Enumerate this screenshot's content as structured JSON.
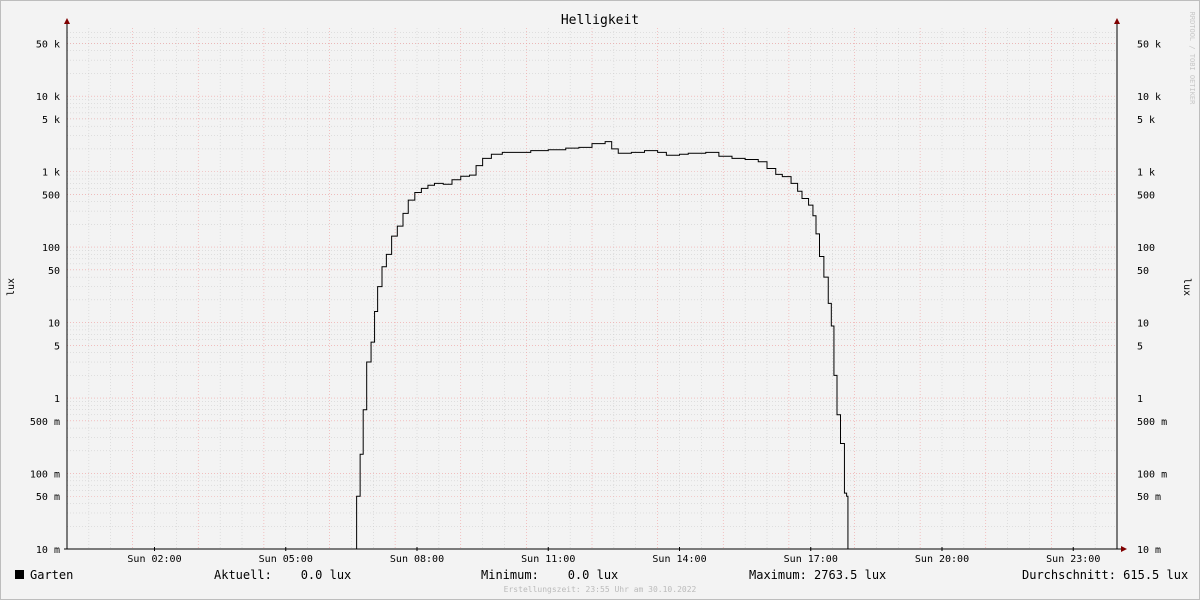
{
  "watermark": "RRDTOOL / TOBI OETIKER",
  "footer": "Erstellungszeit: 23:55 Uhr am 30.10.2022",
  "legend": {
    "series": "Garten",
    "current": "Aktuell:    0.0 lux",
    "minimum": "Minimum:    0.0 lux",
    "maximum": "Maximum: 2763.5 lux",
    "average": "Durchschnitt: 615.5 lux"
  },
  "colors": {
    "line": "#000000",
    "major_grid": "#f0a0a0",
    "minor_grid": "#c8c8c8",
    "axis_arrow": "#800000"
  },
  "chart_data": {
    "type": "line",
    "title": "Helligkeit",
    "ylabel": "lux",
    "yscale": "log",
    "ylim": [
      0.01,
      80000
    ],
    "xlim_hours": [
      0,
      24
    ],
    "grid": true,
    "x_ticks": [
      {
        "hour": 2,
        "label": "Sun 02:00"
      },
      {
        "hour": 5,
        "label": "Sun 05:00"
      },
      {
        "hour": 8,
        "label": "Sun 08:00"
      },
      {
        "hour": 11,
        "label": "Sun 11:00"
      },
      {
        "hour": 14,
        "label": "Sun 14:00"
      },
      {
        "hour": 17,
        "label": "Sun 17:00"
      },
      {
        "hour": 20,
        "label": "Sun 20:00"
      },
      {
        "hour": 23,
        "label": "Sun 23:00"
      }
    ],
    "y_ticks": [
      {
        "value": 0.01,
        "label": "10 m"
      },
      {
        "value": 0.05,
        "label": "50 m"
      },
      {
        "value": 0.1,
        "label": "100 m"
      },
      {
        "value": 0.5,
        "label": "500 m"
      },
      {
        "value": 1,
        "label": "1"
      },
      {
        "value": 5,
        "label": "5"
      },
      {
        "value": 10,
        "label": "10"
      },
      {
        "value": 50,
        "label": "50"
      },
      {
        "value": 100,
        "label": "100"
      },
      {
        "value": 500,
        "label": "500"
      },
      {
        "value": 1000,
        "label": "1 k"
      },
      {
        "value": 5000,
        "label": "5 k"
      },
      {
        "value": 10000,
        "label": "10 k"
      },
      {
        "value": 50000,
        "label": "50 k"
      }
    ],
    "series": [
      {
        "name": "Garten",
        "step": true,
        "points": [
          [
            0,
            0.01
          ],
          [
            6.6,
            0.01
          ],
          [
            6.62,
            0.05
          ],
          [
            6.7,
            0.18
          ],
          [
            6.77,
            0.7
          ],
          [
            6.85,
            3
          ],
          [
            6.95,
            5.5
          ],
          [
            7.03,
            14
          ],
          [
            7.1,
            30
          ],
          [
            7.2,
            55
          ],
          [
            7.3,
            80
          ],
          [
            7.42,
            140
          ],
          [
            7.55,
            190
          ],
          [
            7.68,
            280
          ],
          [
            7.8,
            420
          ],
          [
            7.95,
            530
          ],
          [
            8.1,
            600
          ],
          [
            8.25,
            660
          ],
          [
            8.4,
            700
          ],
          [
            8.6,
            680
          ],
          [
            8.8,
            780
          ],
          [
            9.0,
            870
          ],
          [
            9.2,
            900
          ],
          [
            9.35,
            1200
          ],
          [
            9.5,
            1500
          ],
          [
            9.7,
            1700
          ],
          [
            9.95,
            1800
          ],
          [
            10.3,
            1800
          ],
          [
            10.6,
            1900
          ],
          [
            11.0,
            1950
          ],
          [
            11.4,
            2050
          ],
          [
            11.7,
            2100
          ],
          [
            12.0,
            2350
          ],
          [
            12.3,
            2500
          ],
          [
            12.45,
            2000
          ],
          [
            12.6,
            1750
          ],
          [
            12.9,
            1800
          ],
          [
            13.2,
            1900
          ],
          [
            13.5,
            1800
          ],
          [
            13.7,
            1650
          ],
          [
            14.0,
            1700
          ],
          [
            14.2,
            1750
          ],
          [
            14.6,
            1800
          ],
          [
            14.9,
            1600
          ],
          [
            15.2,
            1500
          ],
          [
            15.5,
            1450
          ],
          [
            15.8,
            1350
          ],
          [
            16.0,
            1100
          ],
          [
            16.2,
            920
          ],
          [
            16.35,
            860
          ],
          [
            16.55,
            700
          ],
          [
            16.7,
            550
          ],
          [
            16.8,
            440
          ],
          [
            16.95,
            360
          ],
          [
            17.05,
            260
          ],
          [
            17.12,
            150
          ],
          [
            17.2,
            75
          ],
          [
            17.3,
            40
          ],
          [
            17.4,
            18
          ],
          [
            17.47,
            9
          ],
          [
            17.53,
            2
          ],
          [
            17.6,
            0.6
          ],
          [
            17.68,
            0.25
          ],
          [
            17.77,
            0.055
          ],
          [
            17.82,
            0.05
          ],
          [
            17.85,
            0.01
          ],
          [
            24,
            0.01
          ]
        ]
      }
    ]
  }
}
